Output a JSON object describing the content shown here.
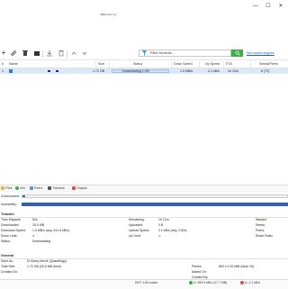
{
  "window": {
    "title": "qBittorrent v4",
    "controls": {
      "minimize": "—",
      "maximize": "☐",
      "close": "✕"
    }
  },
  "toolbar": {
    "buttons": [
      "add-torrent-link",
      "add-torrent-file",
      "delete-torrent",
      "resume",
      "pause",
      "options"
    ],
    "search": {
      "value": "Filter torrents...",
      "placeholder": "Filter torrents..."
    },
    "search_engines_label": "Site search engines"
  },
  "torrent_list": {
    "columns": [
      "#",
      "Name",
      "Size",
      "Status",
      "Down Speed",
      "Up Speed",
      "ETA",
      "Seeds/Peers"
    ],
    "rows": [
      {
        "num": "1",
        "name": "",
        "size": "1.72 GB",
        "status": "Downloading 1.4%",
        "down_speed": "1.0 MB/s",
        "up_speed": "2.1 kB/s",
        "eta": "1h 12m",
        "seeds_peers": "6 (72)"
      }
    ]
  },
  "details_tabs": [
    "Files",
    "Info",
    "Peers",
    "Trackers",
    "Graphs"
  ],
  "pieces": {
    "downloaded_label": "Downloaded:",
    "availability_label": "Availability:"
  },
  "transfer": {
    "heading": "Transfer",
    "left": [
      {
        "label": "Time Elapsed:",
        "value": "52s"
      },
      {
        "label": "Downloaded:",
        "value": "25.0 MB"
      },
      {
        "label": "Download Speed:",
        "value": "1.0 MB/s (avg. 511.6 kB/s)"
      },
      {
        "label": "Down Limit:",
        "value": "∞"
      },
      {
        "label": "Status:",
        "value": "Downloading"
      }
    ],
    "middle": [
      {
        "label": "Remaining:",
        "value": "1h 12m"
      },
      {
        "label": "Uploaded:",
        "value": "0 B"
      },
      {
        "label": "Upload Speed:",
        "value": "2.1 kB/s (avg. 0 B/s)"
      },
      {
        "label": "Up Limit:",
        "value": "∞"
      }
    ],
    "right": [
      {
        "label": "Wasted:",
        "value": ""
      },
      {
        "label": "Seeds:",
        "value": ""
      },
      {
        "label": "Peers:",
        "value": ""
      },
      {
        "label": "Share Ratio:",
        "value": ""
      }
    ]
  },
  "general": {
    "heading": "General",
    "left": [
      {
        "label": "Save As:",
        "value": "D:\\Scary Movie (Quadrilogy)"
      },
      {
        "label": "Total Size:",
        "value": "1.72 GB (25.6 MB done)"
      },
      {
        "label": "Created On:",
        "value": ""
      }
    ],
    "right": [
      {
        "label": "Pieces:",
        "value": "800 x 2.00 MiB (have 15)"
      },
      {
        "label": "Added On:",
        "value": ""
      },
      {
        "label": "Created By:",
        "value": ""
      }
    ]
  },
  "status_bar": {
    "dht": "DHT: 163 nodes",
    "download": "D: 999.9 kB/s (27.7 MB)",
    "upload": "U: 2.1 kB/s"
  },
  "colors": {
    "accent_green": "#3cae48",
    "selection": "#d9e9fb",
    "link": "#1f5fbf"
  }
}
